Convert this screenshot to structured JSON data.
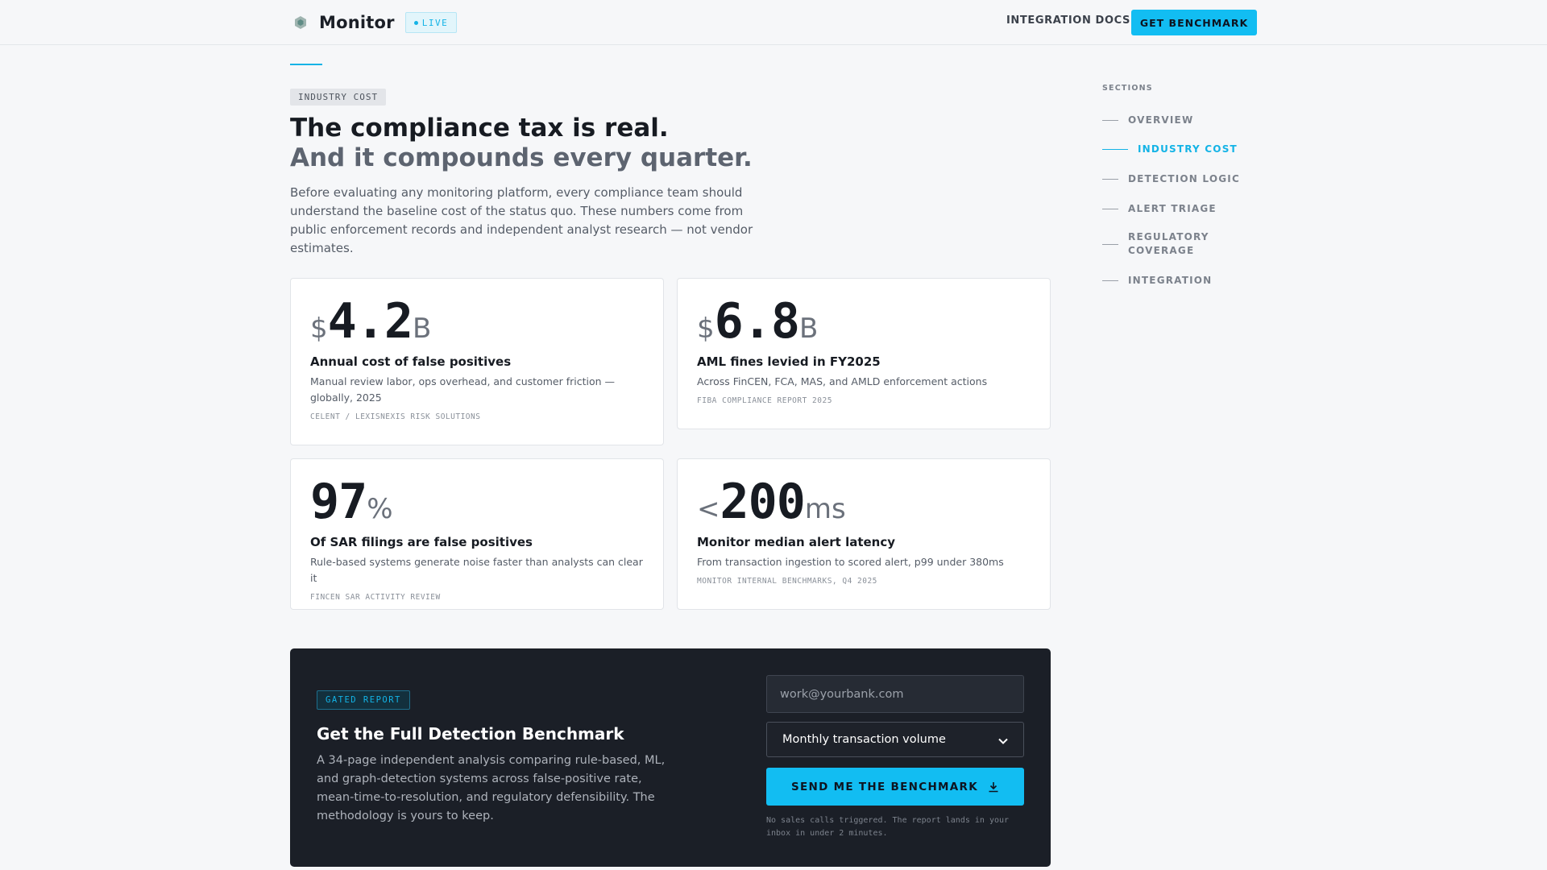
{
  "header": {
    "brand_name": "Monitor",
    "live_badge": "LIVE",
    "nav_docs": "INTEGRATION DOCS",
    "cta": "GET BENCHMARK"
  },
  "hero": {
    "tag": "INDUSTRY COST",
    "headline": "The compliance tax is real.",
    "subhead": "And it compounds every quarter.",
    "intro": "Before evaluating any monitoring platform, every compliance team should understand the baseline cost of the status quo. These numbers come from public enforcement records and independent analyst research — not vendor estimates."
  },
  "stats": [
    {
      "prefix": "$",
      "value": "4.2",
      "suffix": "B",
      "title": "Annual cost of false positives",
      "desc": "Manual review labor, ops overhead, and customer friction — globally, 2025",
      "source": "CELENT / LEXISNEXIS RISK SOLUTIONS"
    },
    {
      "prefix": "$",
      "value": "6.8",
      "suffix": "B",
      "title": "AML fines levied in FY2025",
      "desc": "Across FinCEN, FCA, MAS, and AMLD enforcement actions",
      "source": "FIBA COMPLIANCE REPORT 2025"
    },
    {
      "prefix": "",
      "value": "97",
      "suffix": "%",
      "title": "Of SAR filings are false positives",
      "desc": "Rule-based systems generate noise faster than analysts can clear it",
      "source": "FINCEN SAR ACTIVITY REVIEW"
    },
    {
      "prefix": "<",
      "value": "200",
      "suffix": "ms",
      "title": "Monitor median alert latency",
      "desc": "From transaction ingestion to scored alert, p99 under 380ms",
      "source": "MONITOR INTERNAL BENCHMARKS, Q4 2025"
    }
  ],
  "sections": {
    "heading": "SECTIONS",
    "items": [
      {
        "label": "OVERVIEW"
      },
      {
        "label": "INDUSTRY COST"
      },
      {
        "label": "DETECTION LOGIC"
      },
      {
        "label": "ALERT TRIAGE"
      },
      {
        "label": "REGULATORY COVERAGE"
      },
      {
        "label": "INTEGRATION"
      }
    ],
    "active": "INDUSTRY COST"
  },
  "report": {
    "tag": "GATED REPORT",
    "title": "Get the Full Detection Benchmark",
    "desc": "A 34-page independent analysis comparing rule-based, ML, and graph-detection systems across false-positive rate, mean-time-to-resolution, and regulatory defensibility. The methodology is yours to keep.",
    "email_placeholder": "work@yourbank.com",
    "select_value": "Monthly transaction volume",
    "submit_label": "SEND ME THE BENCHMARK",
    "fine_print": "No sales calls triggered. The report lands in your inbox in under 2 minutes."
  },
  "colors": {
    "accent": "#13b3e6",
    "panel_bg": "#1b1f27",
    "page_bg": "#f6f7f9"
  },
  "icons": {
    "brand": "hexagon-logo-icon",
    "live": "dot-icon",
    "download": "download-icon",
    "select": "chevron-down-icon"
  }
}
